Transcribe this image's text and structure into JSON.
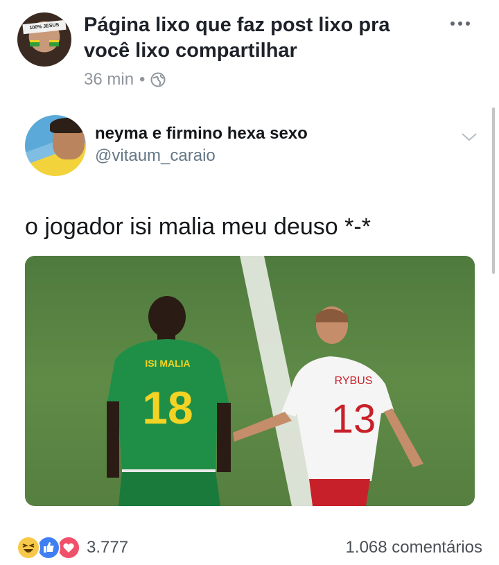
{
  "post": {
    "page_name": "Página lixo que faz post lixo pra você lixo compartilhar",
    "time": "36 min",
    "separator": "•",
    "privacy_icon": "globe-icon",
    "avatar_text": "100% JESUS",
    "menu_icon": "more-horizontal-icon"
  },
  "tweet": {
    "display_name": "neyma e firmino hexa sexo",
    "handle": "@vitaum_caraio",
    "text": "o jogador isi malia meu deuso *-*",
    "menu_icon": "chevron-down-icon"
  },
  "photo": {
    "left_player_name": "ISI MALIA",
    "left_player_number": "18",
    "right_player_name": "RYBUS",
    "right_player_number": "13"
  },
  "footer": {
    "reaction_icons": [
      "haha-icon",
      "like-icon",
      "love-icon"
    ],
    "reaction_count": "3.777",
    "comments": "1.068 comentários"
  },
  "colors": {
    "meta_gray": "#90949c",
    "like_blue": "#3f7ff2",
    "love_red": "#f0506a",
    "haha_yellow": "#f7c94a"
  }
}
